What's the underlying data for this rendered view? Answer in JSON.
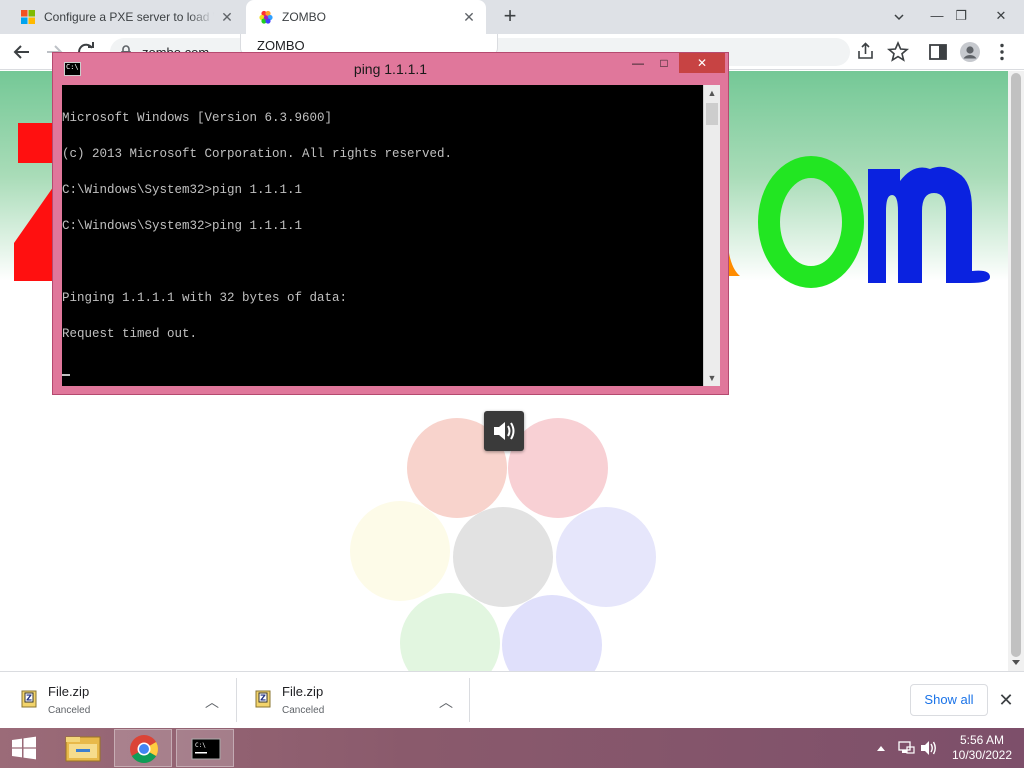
{
  "browser": {
    "tabs": [
      {
        "title": "Configure a PXE server to load W",
        "favicon": "windows-logo-icon",
        "active": false
      },
      {
        "title": "ZOMBO",
        "favicon": "zombo-flower-icon",
        "active": true
      }
    ],
    "new_tab_label": "+",
    "url": "zombo.com",
    "suggestion_text": "ZOMBO"
  },
  "page": {
    "logo_text": "Zombo.com",
    "logo_colors": {
      "z": "#ff1010",
      "o_orange": "#ff8c00",
      "o_green": "#22e622",
      "m_blue": "#0a22e0"
    }
  },
  "cmd_window": {
    "title": "ping  1.1.1.1",
    "minimize": "—",
    "maximize": "□",
    "close": "✕",
    "lines": [
      "Microsoft Windows [Version 6.3.9600]",
      "(c) 2013 Microsoft Corporation. All rights reserved.",
      "C:\\Windows\\System32>pign 1.1.1.1",
      "C:\\Windows\\System32>ping 1.1.1.1",
      "",
      "Pinging 1.1.1.1 with 32 bytes of data:",
      "Request timed out."
    ],
    "colors": {
      "frame": "#e0779b",
      "close": "#c74343",
      "console_bg": "#000000",
      "console_fg": "#c0c0c0"
    }
  },
  "downloads": {
    "items": [
      {
        "name": "File.zip",
        "status": "Canceled"
      },
      {
        "name": "File.zip",
        "status": "Canceled"
      }
    ],
    "show_all": "Show all"
  },
  "taskbar": {
    "clock_time": "5:56 AM",
    "clock_date": "10/30/2022",
    "apps": [
      "file-explorer-icon",
      "chrome-icon",
      "cmd-icon"
    ]
  }
}
